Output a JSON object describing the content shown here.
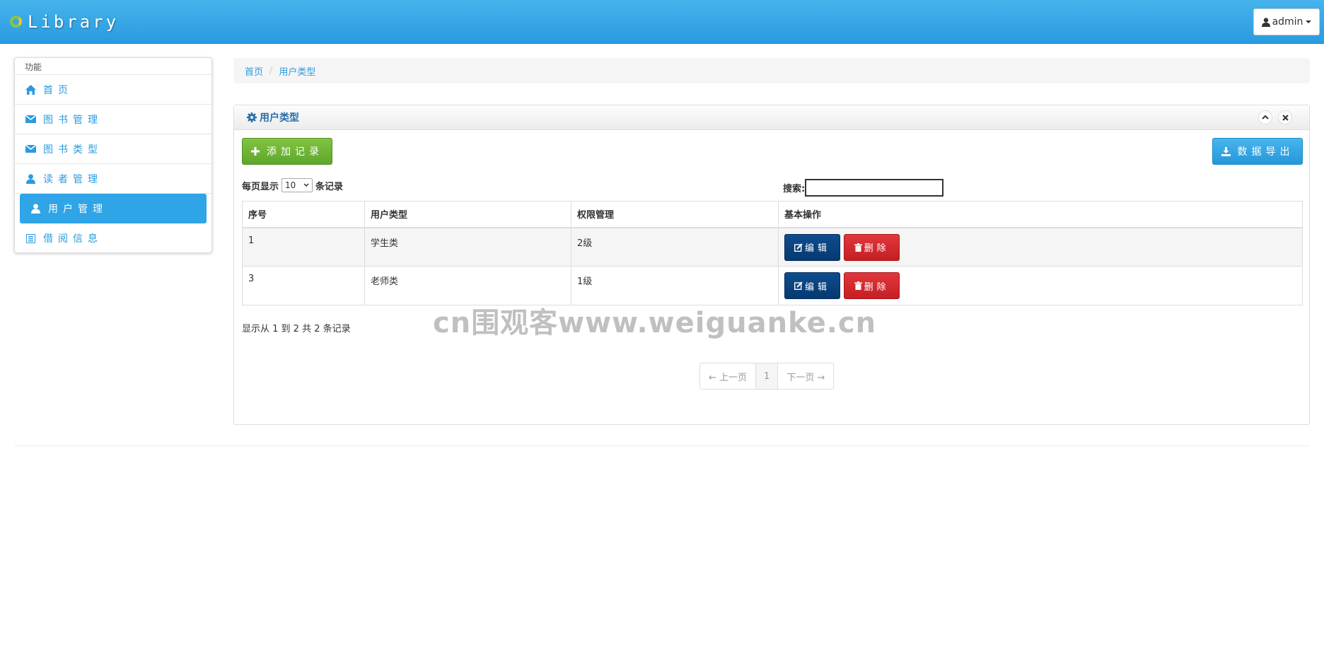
{
  "header": {
    "brand": "Library",
    "user": "admin"
  },
  "sidebar": {
    "title": "功能",
    "items": [
      {
        "label": "首页",
        "icon": "home-icon"
      },
      {
        "label": "图书管理",
        "icon": "envelope-icon"
      },
      {
        "label": "图书类型",
        "icon": "envelope-icon"
      },
      {
        "label": "读者管理",
        "icon": "user-icon"
      },
      {
        "label": "用户管理",
        "icon": "user-icon",
        "active": true
      },
      {
        "label": "借阅信息",
        "icon": "list-icon"
      }
    ]
  },
  "breadcrumb": {
    "home": "首页",
    "current": "用户类型"
  },
  "panel": {
    "title": "用户类型",
    "add_label": "添加记录",
    "export_label": "数据导出",
    "length_prefix": "每页显示",
    "length_value": "10",
    "length_suffix": "条记录",
    "search_label": "搜索:",
    "columns": [
      "序号",
      "用户类型",
      "权限管理",
      "基本操作"
    ],
    "rows": [
      {
        "id": "1",
        "type": "学生类",
        "level": "2级"
      },
      {
        "id": "3",
        "type": "老师类",
        "level": "1级"
      }
    ],
    "edit_label": "编辑",
    "delete_label": "删除",
    "info": "显示从 1 到 2 共 2 条记录",
    "pager": {
      "prev": "← 上一页",
      "current": "1",
      "next": "下一页 →"
    }
  },
  "watermark": "cn围观客www.weiguanke.cn",
  "colors": {
    "accent": "#2fa4e7",
    "success": "#5ea72d",
    "edit": "#063970",
    "danger": "#c41e23"
  }
}
